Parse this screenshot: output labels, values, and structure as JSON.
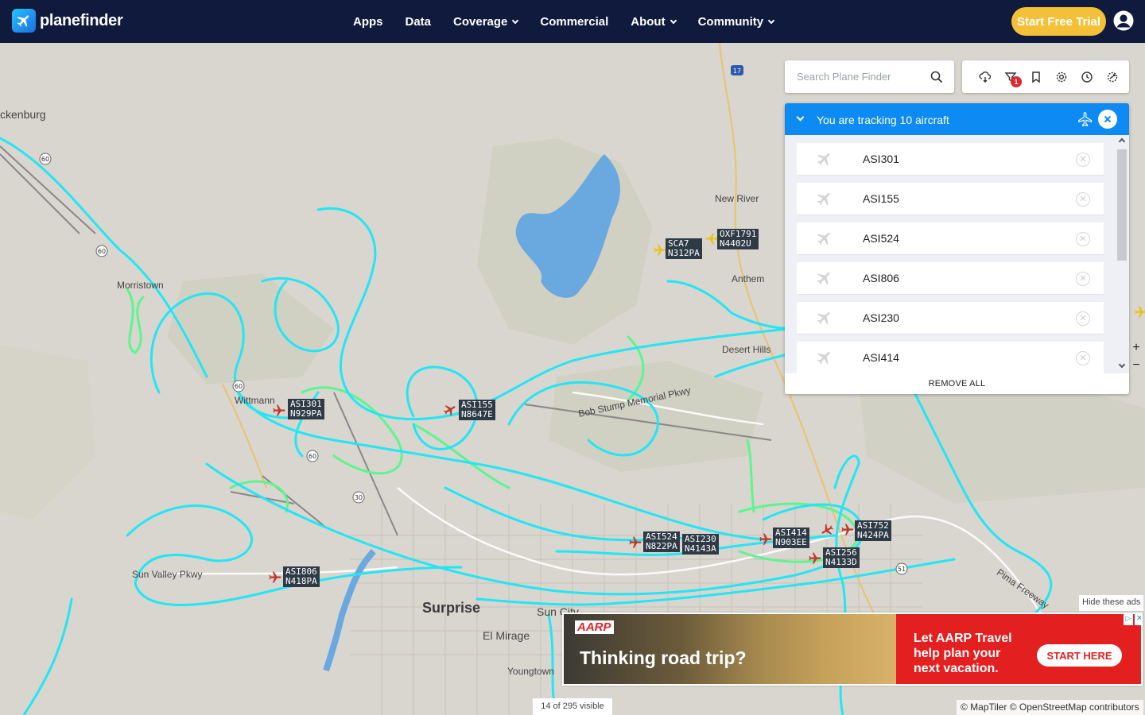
{
  "nav": {
    "brand": "planefinder",
    "items": [
      {
        "label": "Apps",
        "dropdown": false
      },
      {
        "label": "Data",
        "dropdown": false
      },
      {
        "label": "Coverage",
        "dropdown": true
      },
      {
        "label": "Commercial",
        "dropdown": false
      },
      {
        "label": "About",
        "dropdown": true
      },
      {
        "label": "Community",
        "dropdown": true
      }
    ],
    "trial_label": "Start Free Trial",
    "user_icon": "user-circle-icon"
  },
  "search": {
    "placeholder": "Search Plane Finder",
    "icon": "search-icon"
  },
  "toolbar": {
    "icons": [
      "weather-icon",
      "filter-icon",
      "bookmark-icon",
      "settings-icon",
      "history-icon",
      "airport-icon"
    ],
    "filter_badge": "1"
  },
  "tracking": {
    "title": "You are tracking 10 aircraft",
    "items": [
      "ASI301",
      "ASI155",
      "ASI524",
      "ASI806",
      "ASI230",
      "ASI414"
    ],
    "remove_all": "REMOVE ALL"
  },
  "map": {
    "places": [
      {
        "name": "ckenburg",
        "big": false
      },
      {
        "name": "Morristown",
        "big": false
      },
      {
        "name": "Wittmann",
        "big": false
      },
      {
        "name": "New River",
        "big": false
      },
      {
        "name": "Anthem",
        "big": false
      },
      {
        "name": "Desert Hills",
        "big": false
      },
      {
        "name": "Bob Stump Memorial Pkwy",
        "big": false
      },
      {
        "name": "Sun Valley Pkwy",
        "big": false
      },
      {
        "name": "Surprise",
        "big": true
      },
      {
        "name": "Sun City",
        "big": false
      },
      {
        "name": "El Mirage",
        "big": false
      },
      {
        "name": "Youngtown",
        "big": false
      },
      {
        "name": "Pima Freeway",
        "big": false
      }
    ],
    "aircraft": [
      {
        "callsign": "ASI301",
        "reg": "N929PA",
        "color": "#c0392b"
      },
      {
        "callsign": "ASI155",
        "reg": "N8647E",
        "color": "#c0392b"
      },
      {
        "callsign": "SCA7",
        "reg": "N312PA",
        "color": "#e8c21a"
      },
      {
        "callsign": "OXF1791",
        "reg": "N4402U",
        "color": "#e8c21a"
      },
      {
        "callsign": "ASI524",
        "reg": "N822PA",
        "color": "#c0392b"
      },
      {
        "callsign": "ASI230",
        "reg": "N4143A",
        "color": "#c0392b"
      },
      {
        "callsign": "ASI414",
        "reg": "N903EE",
        "color": "#c0392b"
      },
      {
        "callsign": "ASI752",
        "reg": "N424PA",
        "color": "#c0392b"
      },
      {
        "callsign": "ASI256",
        "reg": "N4133D",
        "color": "#c0392b"
      },
      {
        "callsign": "ASI806",
        "reg": "N418PA",
        "color": "#c0392b"
      }
    ],
    "zoom_in": "+",
    "zoom_out": "−",
    "visible_count": "14 of 295 visible",
    "attribution": "© MapTiler © OpenStreetMap contributors",
    "track_color": "#21e6f5",
    "track_color_low": "#5cf58f",
    "water_color": "#6aa8e0"
  },
  "ad": {
    "hide_label": "Hide these ads",
    "brand": "AARP",
    "headline": "Thinking road trip?",
    "copy": "Let AARP Travel help plan your next vacation.",
    "cta": "START HERE"
  }
}
